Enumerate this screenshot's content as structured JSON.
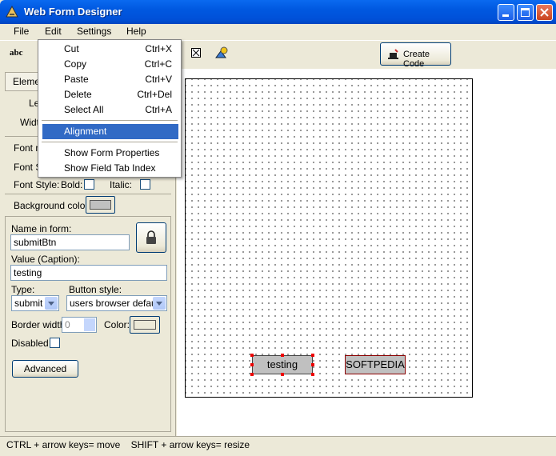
{
  "window": {
    "title": "Web Form Designer"
  },
  "menubar": {
    "items": [
      "File",
      "Edit",
      "Settings",
      "Help"
    ]
  },
  "toolbar": {
    "abc_label": "abc",
    "create_code": "Create Code"
  },
  "edit_menu": {
    "items": [
      {
        "label": "Cut",
        "shortcut": "Ctrl+X"
      },
      {
        "label": "Copy",
        "shortcut": "Ctrl+C"
      },
      {
        "label": "Paste",
        "shortcut": "Ctrl+V"
      },
      {
        "label": "Delete",
        "shortcut": "Ctrl+Del"
      },
      {
        "label": "Select All",
        "shortcut": "Ctrl+A"
      },
      {
        "label": "Alignment",
        "shortcut": ""
      },
      {
        "label": "Show Form Properties",
        "shortcut": ""
      },
      {
        "label": "Show Field Tab Index",
        "shortcut": ""
      }
    ],
    "highlighted": "Alignment"
  },
  "left_panel": {
    "element_label": "Eleme",
    "left_label": "Le",
    "width_label": "Widt",
    "font_name_label": "Font n",
    "font_size_label": "Font S",
    "font_style_label": "Font Style:",
    "bold_label": "Bold:",
    "italic_label": "Italic:",
    "bg_color_label": "Background color:",
    "name_label": "Name in form:",
    "name_value": "submitBtn",
    "value_label": "Value (Caption):",
    "value_value": "testing",
    "type_label": "Type:",
    "type_value": "submit",
    "button_style_label": "Button style:",
    "button_style_value": "users browser default",
    "border_width_label": "Border width:",
    "border_width_value": "0",
    "color_label": "Color:",
    "disabled_label": "Disabled",
    "advanced_button": "Advanced"
  },
  "canvas": {
    "button_testing": "testing",
    "button_softpedia": "SOFTPEDIA"
  },
  "status": {
    "text": "CTRL + arrow keys= move    SHIFT + arrow keys= resize"
  },
  "colors": {
    "accent": "#316AC5",
    "titlebar": "#0058E0",
    "handle": "#EE0000"
  }
}
